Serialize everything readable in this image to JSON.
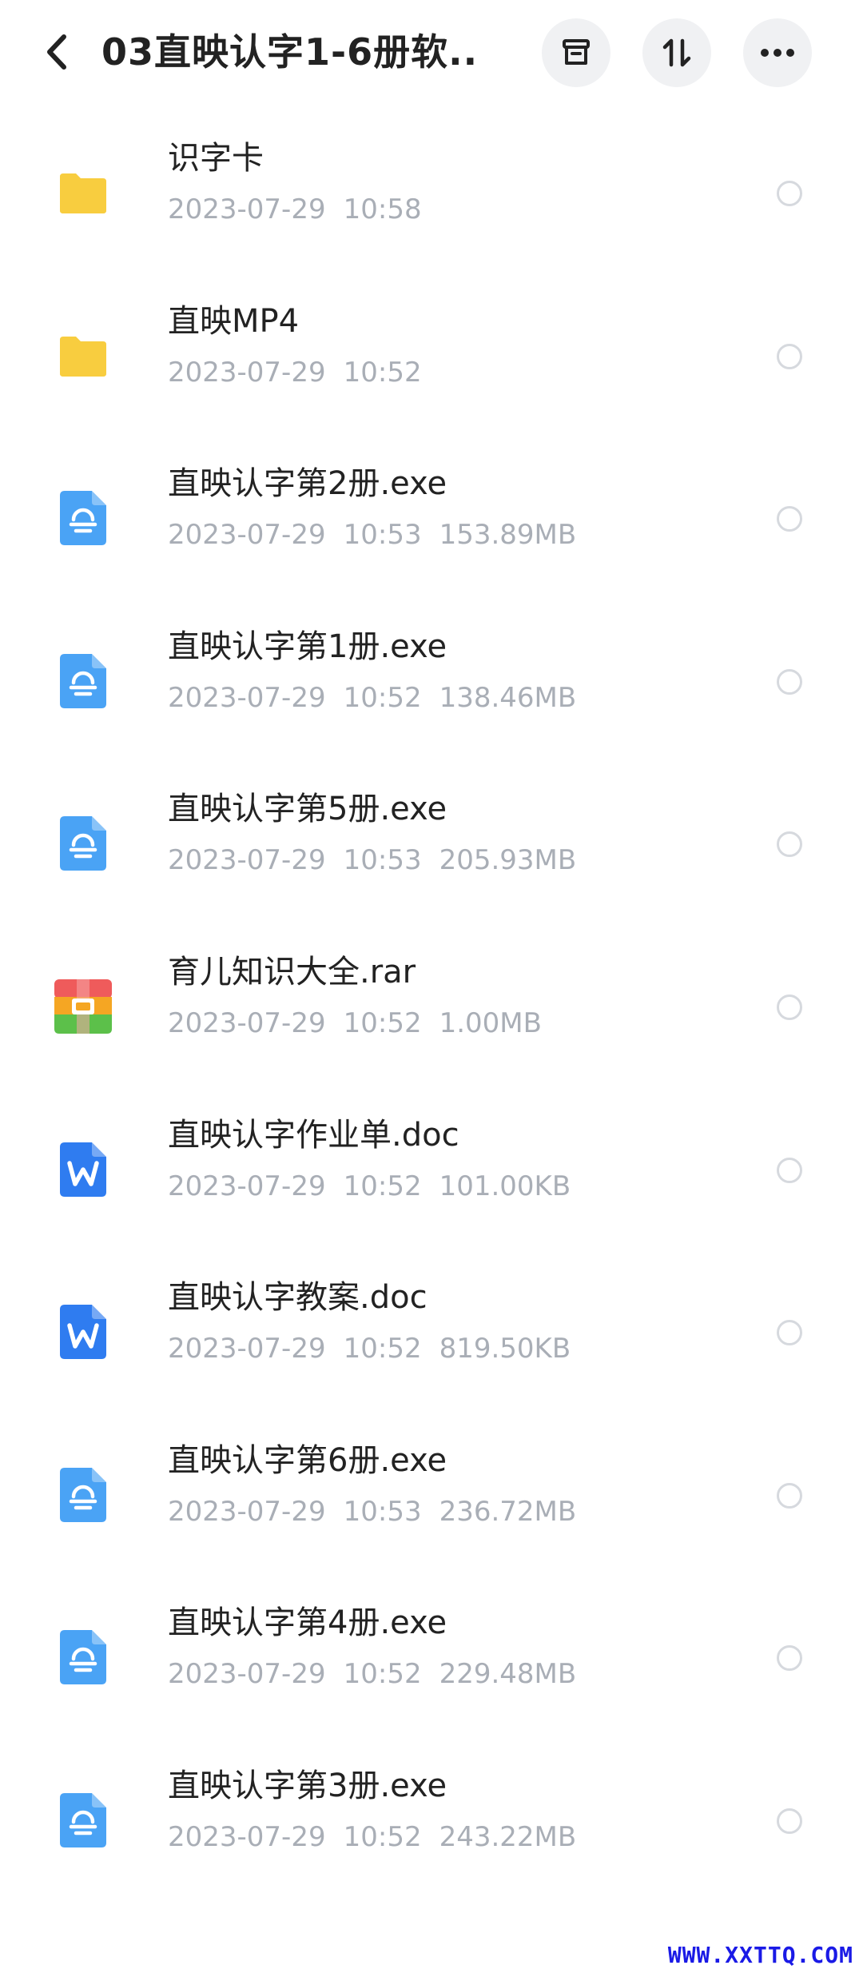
{
  "header": {
    "title": "03直映认字1-6册软...",
    "icons": {
      "back": "chevron-left-icon",
      "archive": "archive-box-icon",
      "sort": "sort-arrows-icon",
      "more": "more-horizontal-icon"
    }
  },
  "colors": {
    "folder": "#f8cd3f",
    "exe": "#4aa3f5",
    "doc": "#2f7cf0",
    "rar_top": "#ef5b5b",
    "rar_mid": "#f5a623",
    "rar_bottom": "#5cc04a"
  },
  "files": [
    {
      "name": "识字卡",
      "date": "2023-07-29",
      "time": "10:58",
      "size": "",
      "type": "folder"
    },
    {
      "name": "直映MP4",
      "date": "2023-07-29",
      "time": "10:52",
      "size": "",
      "type": "folder"
    },
    {
      "name": "直映认字第2册.exe",
      "date": "2023-07-29",
      "time": "10:53",
      "size": "153.89MB",
      "type": "exe"
    },
    {
      "name": "直映认字第1册.exe",
      "date": "2023-07-29",
      "time": "10:52",
      "size": "138.46MB",
      "type": "exe"
    },
    {
      "name": "直映认字第5册.exe",
      "date": "2023-07-29",
      "time": "10:53",
      "size": "205.93MB",
      "type": "exe"
    },
    {
      "name": "育儿知识大全.rar",
      "date": "2023-07-29",
      "time": "10:52",
      "size": "1.00MB",
      "type": "rar"
    },
    {
      "name": "直映认字作业单.doc",
      "date": "2023-07-29",
      "time": "10:52",
      "size": "101.00KB",
      "type": "doc"
    },
    {
      "name": "直映认字教案.doc",
      "date": "2023-07-29",
      "time": "10:52",
      "size": "819.50KB",
      "type": "doc"
    },
    {
      "name": "直映认字第6册.exe",
      "date": "2023-07-29",
      "time": "10:53",
      "size": "236.72MB",
      "type": "exe"
    },
    {
      "name": "直映认字第4册.exe",
      "date": "2023-07-29",
      "time": "10:52",
      "size": "229.48MB",
      "type": "exe"
    },
    {
      "name": "直映认字第3册.exe",
      "date": "2023-07-29",
      "time": "10:52",
      "size": "243.22MB",
      "type": "exe"
    }
  ],
  "watermark": "WWW.XXTTQ.COM"
}
